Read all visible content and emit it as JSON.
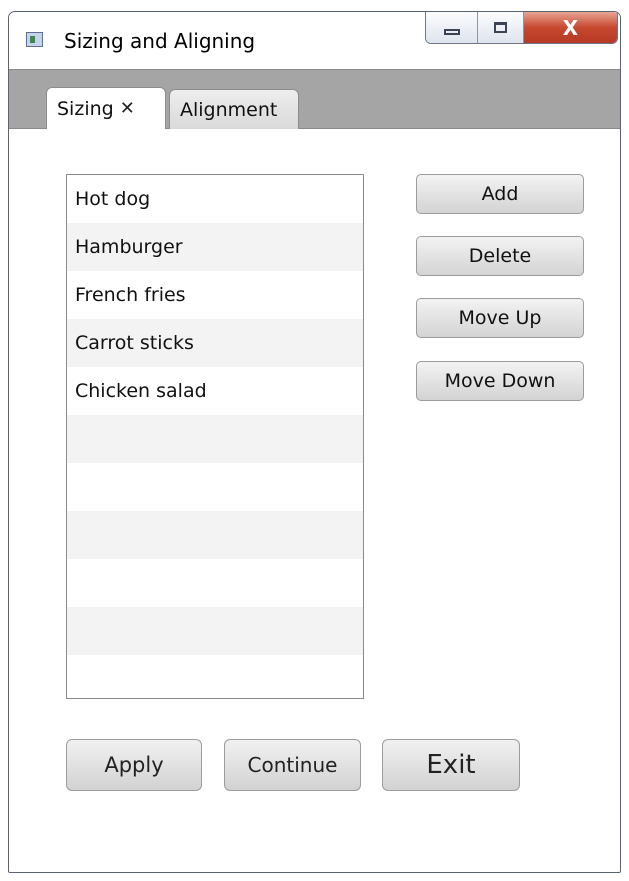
{
  "window": {
    "title": "Sizing and Aligning",
    "controls": {
      "minimize": "minimize",
      "maximize": "maximize",
      "close": "X"
    }
  },
  "tabs": [
    {
      "label": "Sizing",
      "close_glyph": "✕",
      "selected": true
    },
    {
      "label": "Alignment",
      "selected": false
    }
  ],
  "list": {
    "items": [
      "Hot dog",
      "Hamburger",
      "French fries",
      "Carrot sticks",
      "Chicken salad",
      "",
      "",
      "",
      "",
      "",
      ""
    ]
  },
  "side_buttons": {
    "add": "Add",
    "delete": "Delete",
    "move_up": "Move Up",
    "move_down": "Move Down"
  },
  "bottom_buttons": {
    "apply": "Apply",
    "continue": "Continue",
    "exit": "Exit"
  }
}
